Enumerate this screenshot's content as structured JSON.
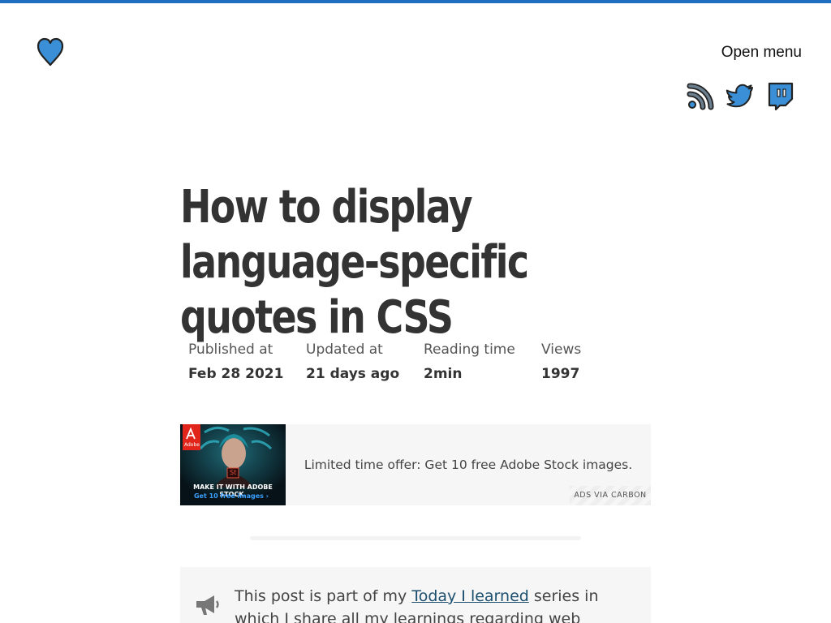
{
  "header": {
    "logo_icon": "heart-icon",
    "menu_label": "Open menu",
    "social": [
      {
        "name": "rss-icon"
      },
      {
        "name": "twitter-icon"
      },
      {
        "name": "twitch-icon"
      }
    ]
  },
  "article": {
    "title": "How to display language-specific quotes in CSS",
    "meta": [
      {
        "label": "Published at",
        "value": "Feb 28 2021"
      },
      {
        "label": "Updated at",
        "value": "21 days ago"
      },
      {
        "label": "Reading time",
        "value": "2min"
      },
      {
        "label": "Views",
        "value": "1997"
      }
    ]
  },
  "ad": {
    "image_badge": "Adobe",
    "image_headline": "MAKE IT WITH ADOBE STOCK.",
    "image_cta": "Get 10 free images ›",
    "image_product": "St",
    "text": "Limited time offer: Get 10 free Adobe Stock images.",
    "via": "ADS VIA CARBON"
  },
  "note": {
    "icon": "megaphone-icon",
    "text_before": "This post is part of my ",
    "link_text": "Today I learned",
    "text_after": " series in which I share all my learnings regarding web development."
  },
  "colors": {
    "accent": "#1e6fbf",
    "icon_blue": "#3a8fd6",
    "link": "#1c4f6e"
  }
}
